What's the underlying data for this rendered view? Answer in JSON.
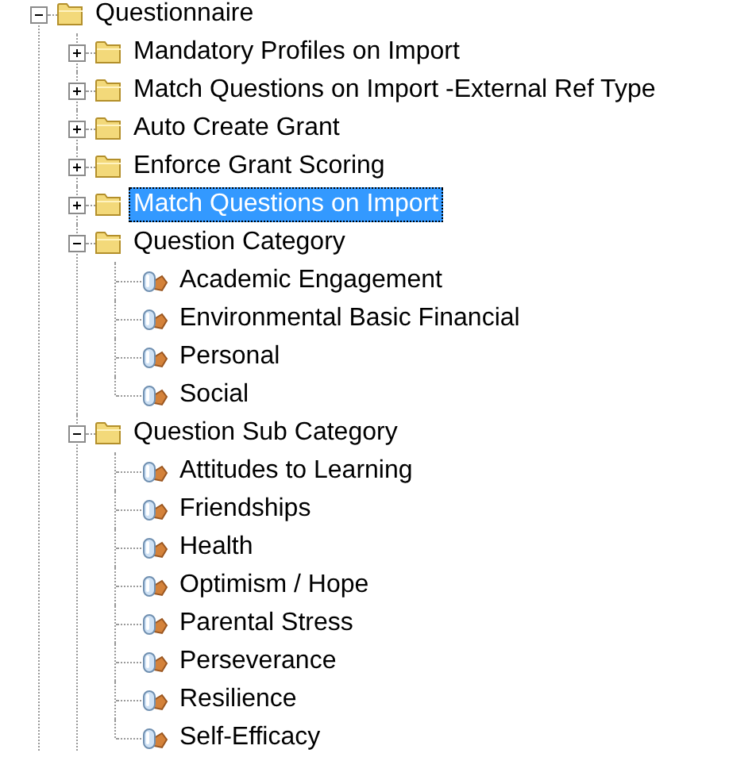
{
  "tree": [
    {
      "label": "Questionnaire",
      "kind": "folder",
      "expanded": true,
      "selected": false,
      "children": [
        {
          "label": "Mandatory Profiles on Import",
          "kind": "folder",
          "expanded": false,
          "selected": false
        },
        {
          "label": "Match Questions on Import -External Ref Type",
          "kind": "folder",
          "expanded": false,
          "selected": false
        },
        {
          "label": "Auto Create Grant",
          "kind": "folder",
          "expanded": false,
          "selected": false
        },
        {
          "label": "Enforce Grant Scoring",
          "kind": "folder",
          "expanded": false,
          "selected": false
        },
        {
          "label": "Match Questions on Import",
          "kind": "folder",
          "expanded": false,
          "selected": true
        },
        {
          "label": "Question Category",
          "kind": "folder",
          "expanded": true,
          "selected": false,
          "children": [
            {
              "label": "Academic Engagement",
              "kind": "leaf",
              "selected": false
            },
            {
              "label": "Environmental Basic Financial",
              "kind": "leaf",
              "selected": false
            },
            {
              "label": "Personal",
              "kind": "leaf",
              "selected": false
            },
            {
              "label": "Social",
              "kind": "leaf",
              "selected": false
            }
          ]
        },
        {
          "label": "Question Sub Category",
          "kind": "folder",
          "expanded": true,
          "selected": false,
          "children": [
            {
              "label": "Attitudes to Learning",
              "kind": "leaf",
              "selected": false
            },
            {
              "label": "Friendships",
              "kind": "leaf",
              "selected": false
            },
            {
              "label": "Health",
              "kind": "leaf",
              "selected": false
            },
            {
              "label": "Optimism / Hope",
              "kind": "leaf",
              "selected": false
            },
            {
              "label": "Parental Stress",
              "kind": "leaf",
              "selected": false
            },
            {
              "label": "Perseverance",
              "kind": "leaf",
              "selected": false
            },
            {
              "label": "Resilience",
              "kind": "leaf",
              "selected": false
            },
            {
              "label": "Self-Efficacy",
              "kind": "leaf",
              "selected": false
            }
          ]
        }
      ]
    }
  ]
}
